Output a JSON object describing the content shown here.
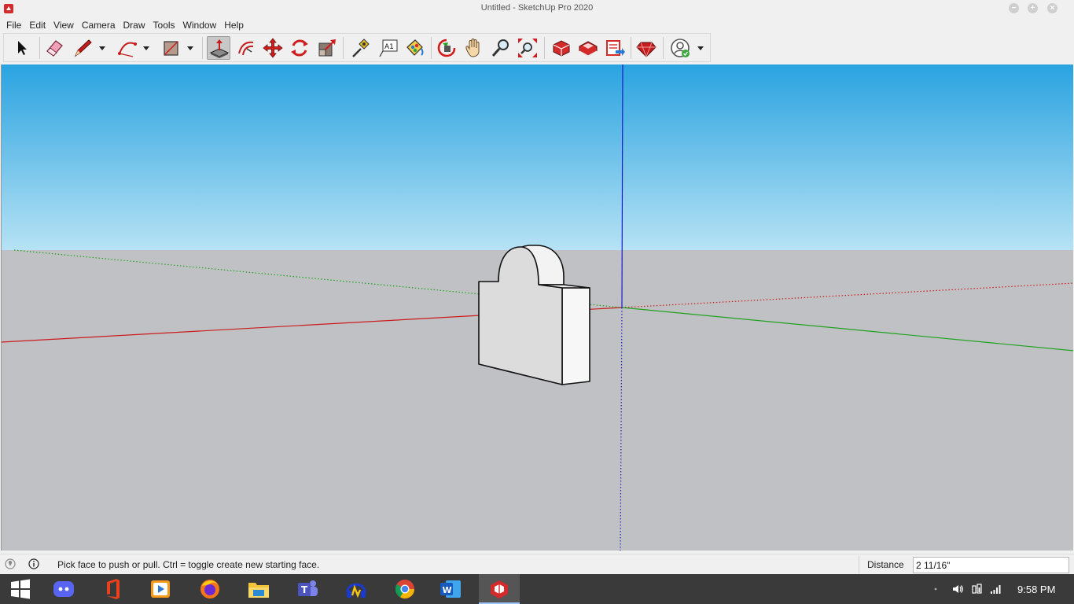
{
  "window": {
    "title": "Untitled - SketchUp Pro 2020",
    "min_glyph": "−",
    "max_glyph": "+",
    "close_glyph": "×"
  },
  "menu": [
    "File",
    "Edit",
    "View",
    "Camera",
    "Draw",
    "Tools",
    "Window",
    "Help"
  ],
  "toolbar": {
    "tools": [
      "select-tool",
      "eraser-tool",
      "pencil-line-tool",
      "arc-tool",
      "rectangle-tool",
      "push-pull-tool",
      "offset-tool",
      "move-tool",
      "rotate-tool",
      "scale-tool",
      "tape-measure-tool",
      "text-tool",
      "paint-bucket-tool",
      "orbit-tool",
      "pan-tool",
      "zoom-tool",
      "zoom-extents-tool",
      "3d-warehouse-tool",
      "extension-warehouse-tool",
      "layout-send-tool",
      "extension-manager-tool",
      "account-tool"
    ],
    "active_tool": "push-pull-tool"
  },
  "viewport": {
    "sky_top": "#2aa3e0",
    "sky_bottom": "#b6e2f4",
    "ground": "#c0c1c5",
    "axis_red": "#cc1c1c",
    "axis_green": "#1fa31f",
    "axis_blue": "#1c1ccc"
  },
  "statusbar": {
    "hint": "Pick face to push or pull.  Ctrl = toggle create new starting face.",
    "measurement_label": "Distance",
    "measurement_value": "2 11/16\""
  },
  "taskbar": {
    "apps": [
      "windows-start",
      "discord",
      "office",
      "video-player",
      "firefox",
      "file-explorer",
      "teams",
      "audio-app",
      "chrome",
      "word",
      "sketchup"
    ],
    "active_app": "sketchup",
    "clock": "9:58 PM"
  }
}
